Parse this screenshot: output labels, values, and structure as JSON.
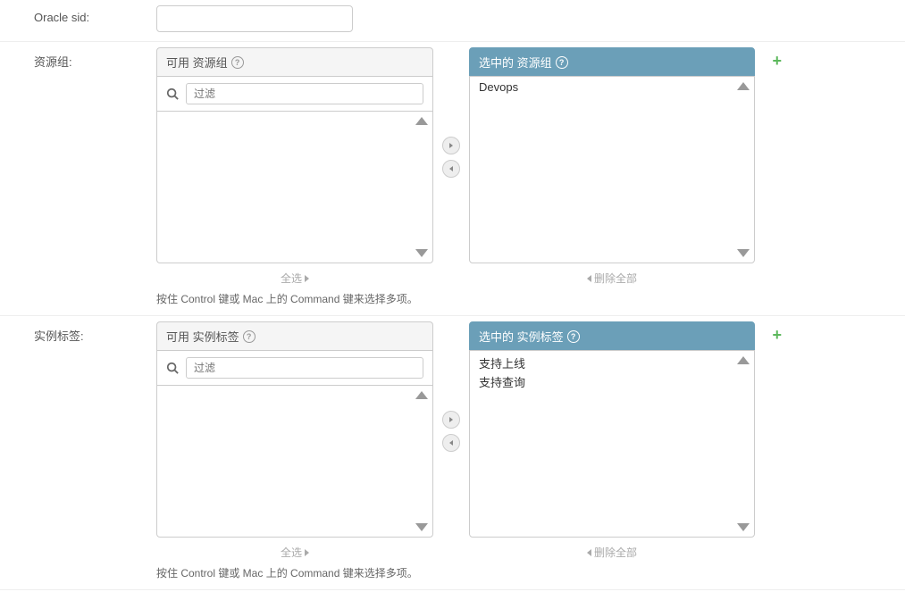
{
  "labels": {
    "oracle_sid": "Oracle sid:",
    "resource_group": "资源组:",
    "instance_tag": "实例标签:"
  },
  "dual_selector": {
    "resource_group": {
      "available_header": "可用 资源组",
      "selected_header": "选中的 资源组",
      "filter_placeholder": "过滤",
      "select_all": "全选",
      "remove_all": "删除全部",
      "help_text": "按住 Control 键或 Mac 上的 Command 键来选择多项。",
      "selected_items": [
        "Devops"
      ]
    },
    "instance_tag": {
      "available_header": "可用 实例标签",
      "selected_header": "选中的 实例标签",
      "filter_placeholder": "过滤",
      "select_all": "全选",
      "remove_all": "删除全部",
      "help_text": "按住 Control 键或 Mac 上的 Command 键来选择多项。",
      "selected_items": [
        "支持上线",
        "支持查询"
      ]
    }
  }
}
